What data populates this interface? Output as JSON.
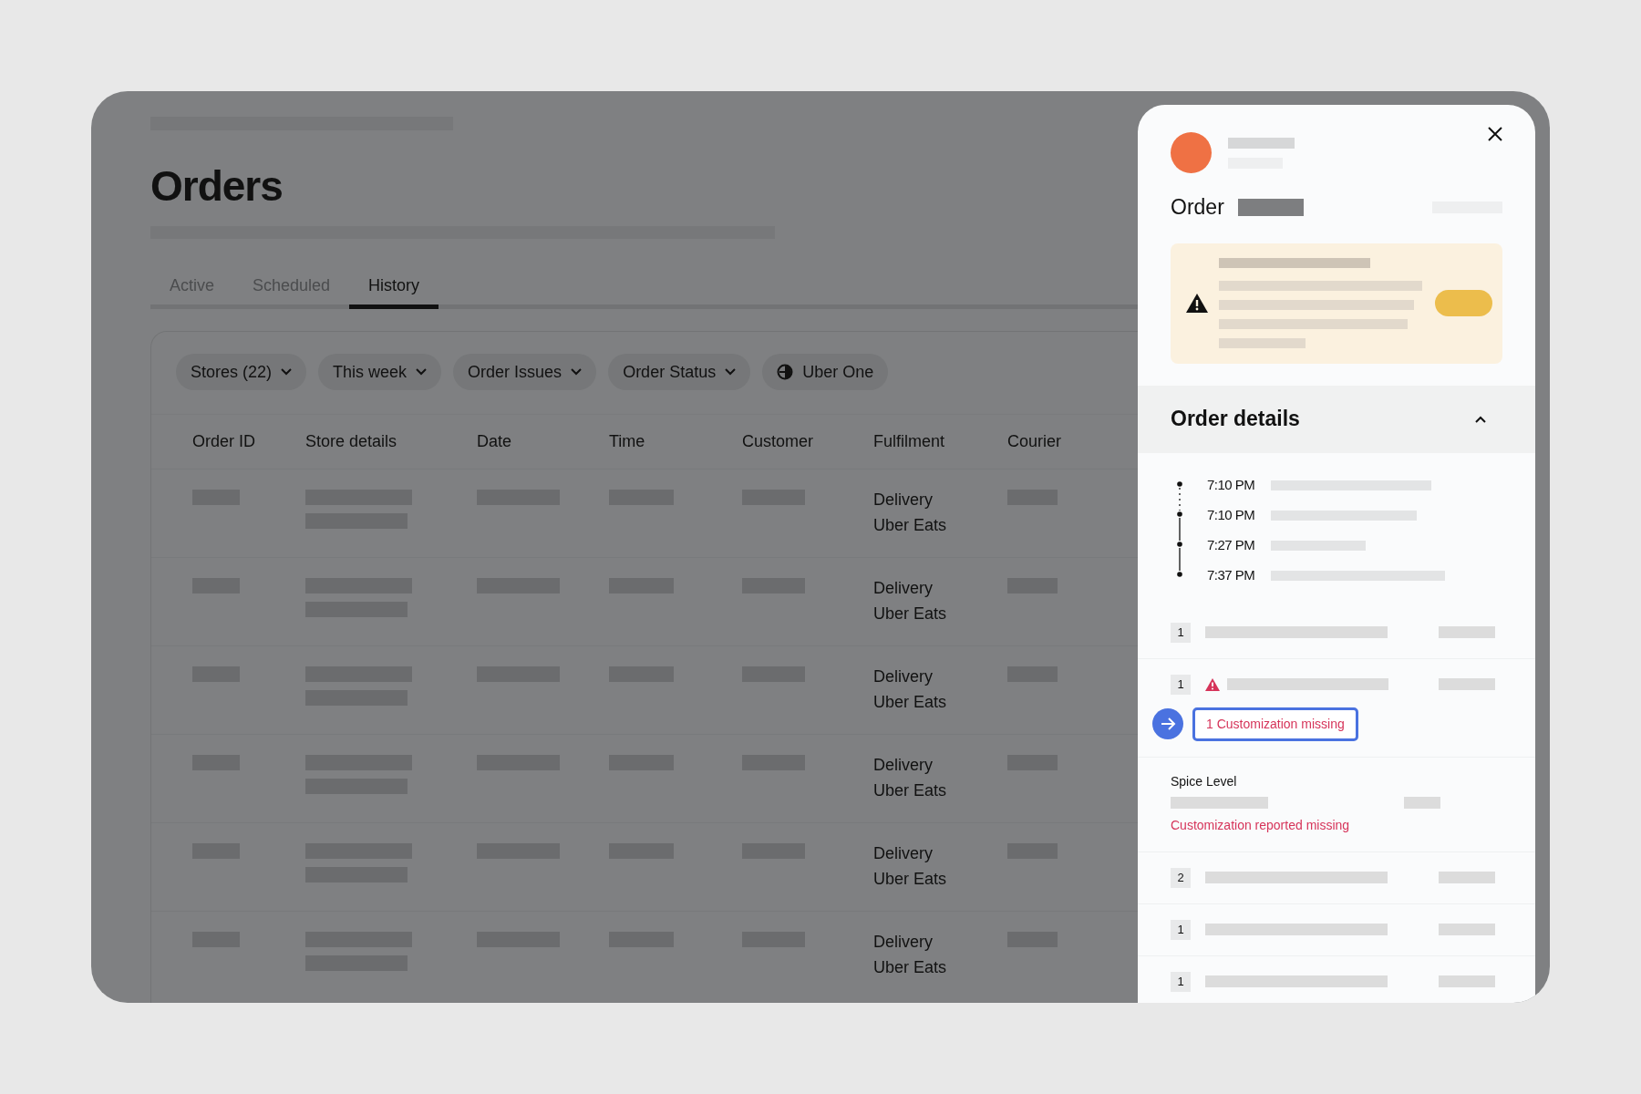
{
  "page": {
    "title": "Orders"
  },
  "tabs": [
    {
      "label": "Active",
      "selected": false
    },
    {
      "label": "Scheduled",
      "selected": false
    },
    {
      "label": "History",
      "selected": true
    }
  ],
  "filters": [
    {
      "label": "Stores (22)",
      "kind": "dropdown"
    },
    {
      "label": "This week",
      "kind": "dropdown"
    },
    {
      "label": "Order Issues",
      "kind": "dropdown"
    },
    {
      "label": "Order Status",
      "kind": "dropdown"
    },
    {
      "label": "Uber One",
      "kind": "toggle"
    }
  ],
  "table": {
    "columns": [
      "Order ID",
      "Store details",
      "Date",
      "Time",
      "Customer",
      "Fulfilment",
      "Courier"
    ],
    "rows": [
      {
        "fulfilment": {
          "method": "Delivery",
          "platform": "Uber Eats"
        }
      },
      {
        "fulfilment": {
          "method": "Delivery",
          "platform": "Uber Eats"
        }
      },
      {
        "fulfilment": {
          "method": "Delivery",
          "platform": "Uber Eats"
        }
      },
      {
        "fulfilment": {
          "method": "Delivery",
          "platform": "Uber Eats"
        }
      },
      {
        "fulfilment": {
          "method": "Delivery",
          "platform": "Uber Eats"
        }
      },
      {
        "fulfilment": {
          "method": "Delivery",
          "platform": "Uber Eats"
        }
      }
    ]
  },
  "panel": {
    "title": "Order",
    "details": {
      "title": "Order details",
      "expanded": true
    },
    "timeline": [
      {
        "time": "7:10 PM"
      },
      {
        "time": "7:10 PM"
      },
      {
        "time": "7:27 PM"
      },
      {
        "time": "7:37 PM"
      }
    ],
    "items": [
      {
        "kind": "item",
        "quantity": "1",
        "flagged": false
      },
      {
        "kind": "item",
        "quantity": "1",
        "flagged": true,
        "issue": "1 Customization missing"
      },
      {
        "kind": "modifier",
        "title": "Spice Level",
        "note": "Customization reported missing"
      },
      {
        "kind": "item",
        "quantity": "2",
        "flagged": false
      },
      {
        "kind": "item",
        "quantity": "1",
        "flagged": false
      },
      {
        "kind": "item",
        "quantity": "1",
        "flagged": false
      }
    ]
  }
}
